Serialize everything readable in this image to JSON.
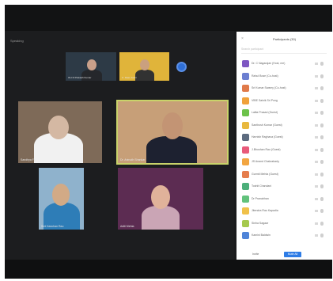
{
  "app": {
    "view_label": "Speaking"
  },
  "thumbnails": [
    {
      "name": "OLI D Prakash Kumar",
      "bg": "#2d3a46",
      "skin": "#c9a08a",
      "shirt": "#25272b"
    },
    {
      "name": "C. Dass Joshi",
      "bg": "#e0b43a",
      "skin": "#caa07f",
      "shirt": "#323232"
    }
  ],
  "tiles": [
    {
      "name": "Sandhya Fr.",
      "bg": "#7e6a58",
      "skin": "#d4b8a3",
      "shirt": "#f1f1f1",
      "active": false
    },
    {
      "name": "Dr. Anirudh Shankar",
      "bg": "#c79f78",
      "skin": "#c39474",
      "shirt": "#1d2130",
      "active": true
    },
    {
      "name": "Smt Kanchan Rao",
      "bg": "#8fb2cc",
      "skin": "#d2aa86",
      "shirt": "#2e7db7",
      "active": false
    },
    {
      "name": "Aditi Mehta",
      "bg": "#5c2c52",
      "skin": "#e0b29a",
      "shirt": "#caa5b5",
      "active": false
    }
  ],
  "panel": {
    "title": "Participants (30)",
    "close": "×",
    "search_placeholder": "Search participant",
    "participants": [
      {
        "name": "Dr. C Nagarajan (Host, me)",
        "color": "#7e57c2"
      },
      {
        "name": "Rahul Bose (Co-host)",
        "color": "#6c7fd1"
      },
      {
        "name": "Sri Kumar Swamy (Co-host)",
        "color": "#e07a4a"
      },
      {
        "name": "VIBE Sainik Sri Pong",
        "color": "#f0a13a"
      },
      {
        "name": "Lalita Prasad (Guest)",
        "color": "#6cc24a"
      },
      {
        "name": "Santhosh Kumar (Guest)",
        "color": "#e8b83e"
      },
      {
        "name": "Harnish Raghava (Guest)",
        "color": "#5d6b7f"
      },
      {
        "name": "J.Bhushan Rao (Guest)",
        "color": "#e85a7a"
      },
      {
        "name": "JS Anand Chakrabarty",
        "color": "#f2a541"
      },
      {
        "name": "Gurmit Mehta (Guest)",
        "color": "#e57d4c"
      },
      {
        "name": "Toshit Chandani",
        "color": "#4caf7a"
      },
      {
        "name": "Dr Pranabhan",
        "color": "#62c27c"
      },
      {
        "name": "Jitendra Rao Kapadia",
        "color": "#f0c14a"
      },
      {
        "name": "Sinha Sagaar",
        "color": "#a5c94d"
      },
      {
        "name": "Kamini Baldwin",
        "color": "#4f84d8"
      }
    ],
    "footer": {
      "invite": "Invite",
      "mute_all": "Mute All"
    }
  }
}
